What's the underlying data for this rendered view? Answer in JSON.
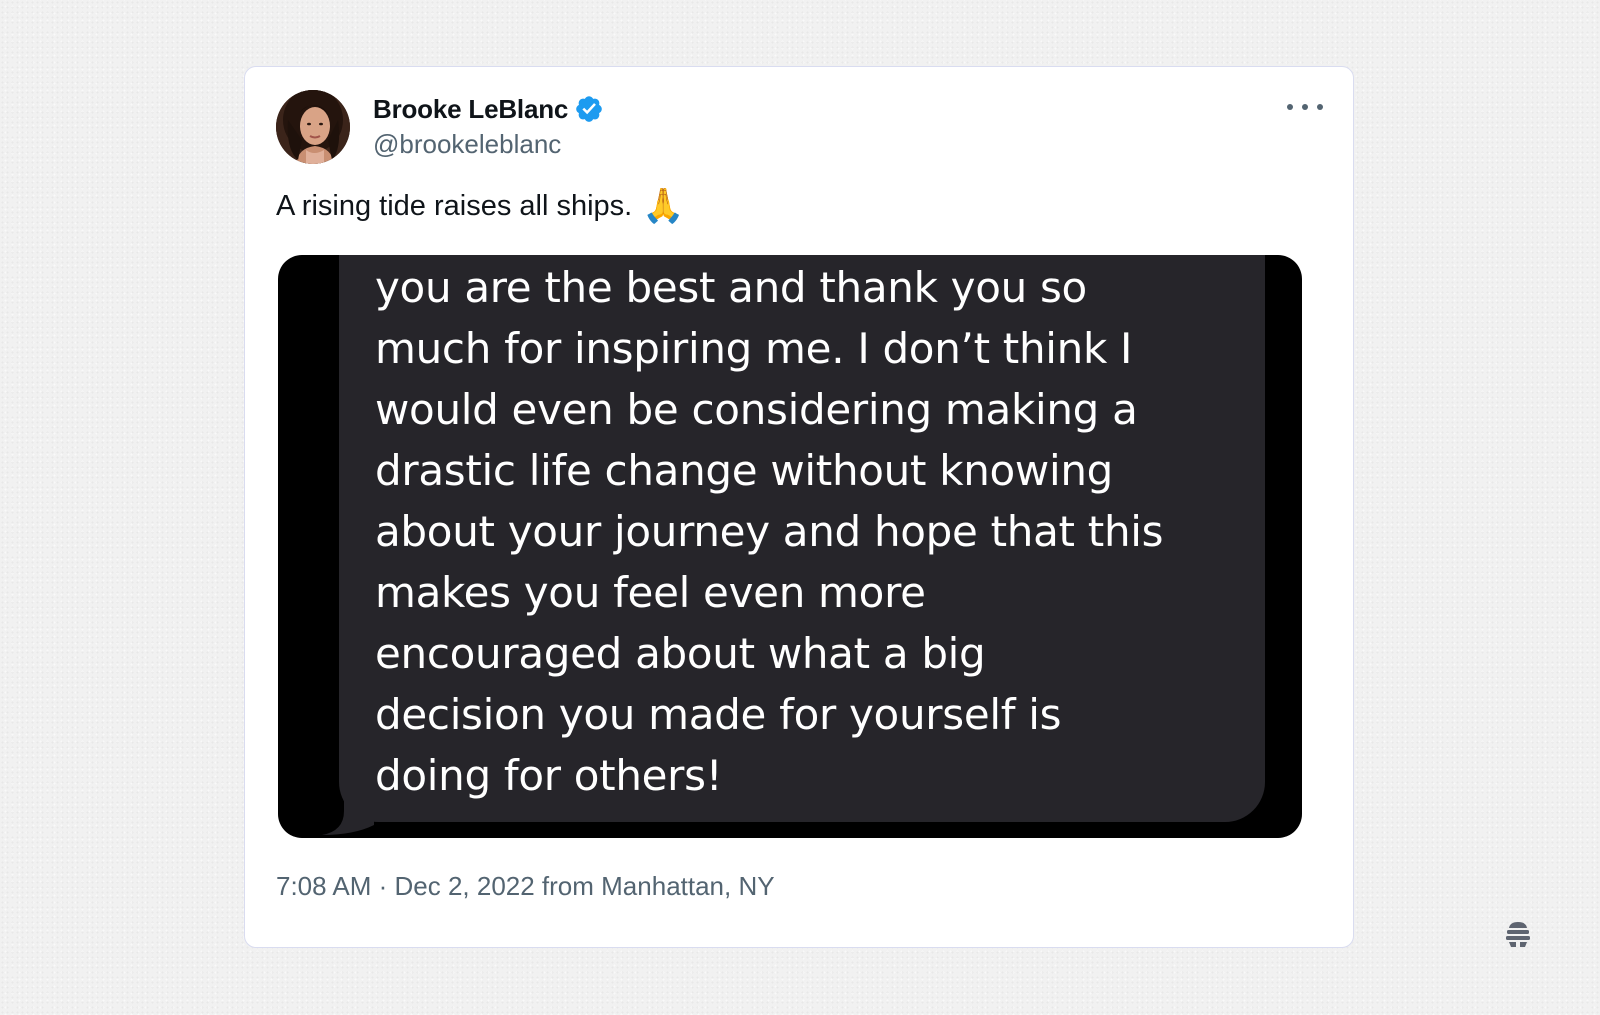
{
  "tweet": {
    "author_name": "Brooke LeBlanc",
    "author_handle": "@brookeleblanc",
    "verified_icon": "verified-badge-icon",
    "more_icon": "more-options-icon",
    "text": "A rising tide raises all ships.",
    "emoji": "🙏",
    "media": {
      "message_text": "you are the best and thank you so\nmuch for inspiring me. I don’t think I\nwould even be considering making a\ndrastic life change without knowing\nabout your journey and hope that this\nmakes you feel even more\nencouraged about what a big\ndecision you made for yourself is\ndoing for others!"
    },
    "timestamp": "7:08 AM · Dec 2, 2022 from Manhattan, NY"
  },
  "colors": {
    "verified_blue": "#1d9bf0",
    "text_primary": "#0f1419",
    "text_secondary": "#536471",
    "bubble_gray": "#26252a",
    "card_border": "#d9dcf0"
  }
}
